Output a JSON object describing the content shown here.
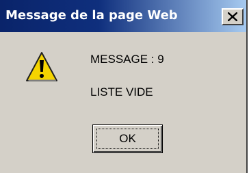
{
  "dialog": {
    "title": "Message de la page Web",
    "close_symbol": "×",
    "icon": "warning-icon",
    "message_line_1": "MESSAGE : 9",
    "message_line_2": "LISTE VIDE",
    "ok_label": "OK"
  },
  "colors": {
    "titlebar_start": "#0a246a",
    "titlebar_end": "#a6caf0",
    "dialog_face": "#d4d0c8",
    "warning_yellow": "#f5d400"
  }
}
